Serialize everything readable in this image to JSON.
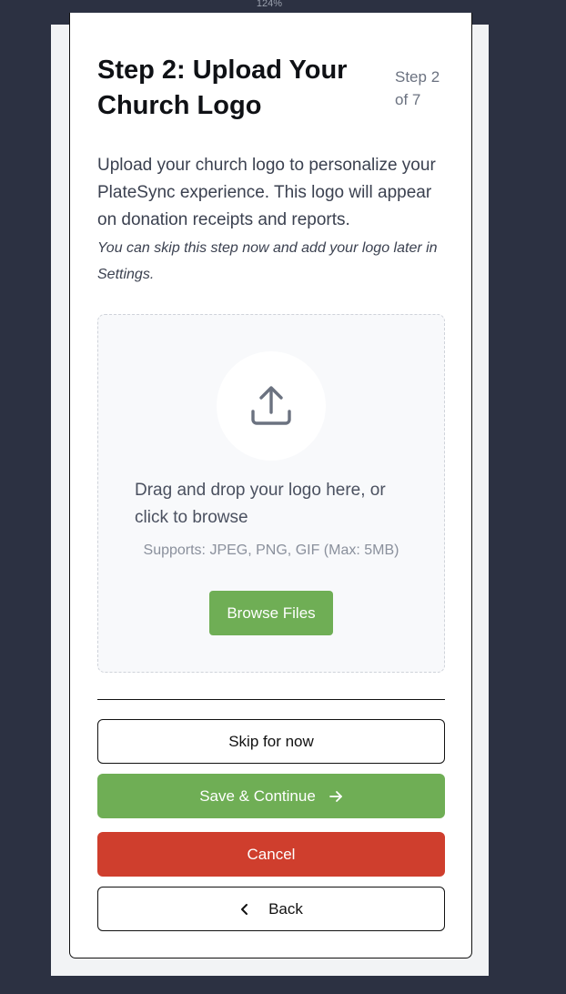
{
  "browser": {
    "zoom_label": "124%"
  },
  "header": {
    "title": "Step 2: Upload Your Church Logo",
    "step_indicator": "Step 2 of 7"
  },
  "intro": {
    "description": "Upload your church logo to personalize your PlateSync experience. This logo will appear on donation receipts and reports.",
    "skip_note": "You can skip this step now and add your logo later in Settings."
  },
  "dropzone": {
    "icon": "upload-icon",
    "instruction": "Drag and drop your logo here, or click to browse",
    "supports": "Supports: JPEG, PNG, GIF (Max: 5MB)",
    "browse_label": "Browse Files"
  },
  "actions": {
    "skip_label": "Skip for now",
    "save_label": "Save & Continue",
    "save_icon": "arrow-right-icon",
    "cancel_label": "Cancel",
    "back_label": "Back",
    "back_icon": "chevron-left-icon"
  },
  "colors": {
    "primary_green": "#6fae55",
    "danger_red": "#cf3e2d",
    "page_background": "#2c3142"
  }
}
